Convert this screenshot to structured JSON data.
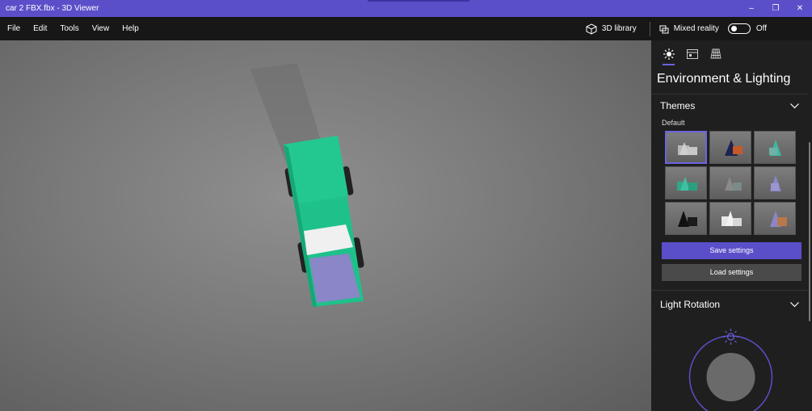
{
  "window": {
    "title": "car 2 FBX.fbx - 3D Viewer",
    "minimize": "–",
    "restore": "❐",
    "close": "✕"
  },
  "menu": {
    "items": [
      "File",
      "Edit",
      "Tools",
      "View",
      "Help"
    ]
  },
  "toolbar": {
    "library_label": "3D library",
    "mixed_reality_label": "Mixed reality",
    "mixed_reality_state": "Off"
  },
  "panel": {
    "heading": "Environment & Lighting",
    "themes": {
      "title": "Themes",
      "subtitle": "Default",
      "items": [
        {
          "name": "theme-1",
          "accent": "#9a9a9a",
          "selected": true
        },
        {
          "name": "theme-2",
          "accent": "#c45a2a"
        },
        {
          "name": "theme-3",
          "accent": "#3fb7a0"
        },
        {
          "name": "theme-4",
          "accent": "#2fa88a"
        },
        {
          "name": "theme-5",
          "accent": "#7a8a88"
        },
        {
          "name": "theme-6",
          "accent": "#8a86c8"
        },
        {
          "name": "theme-7",
          "accent": "#111111"
        },
        {
          "name": "theme-8",
          "accent": "#d8d8d8"
        },
        {
          "name": "theme-9",
          "accent": "#b8784a"
        }
      ]
    },
    "save_label": "Save settings",
    "load_label": "Load settings",
    "light_rotation_title": "Light Rotation"
  },
  "colors": {
    "accent": "#5b4fc9",
    "car_body": "#1fc18a",
    "car_bed": "#8a86c8"
  }
}
